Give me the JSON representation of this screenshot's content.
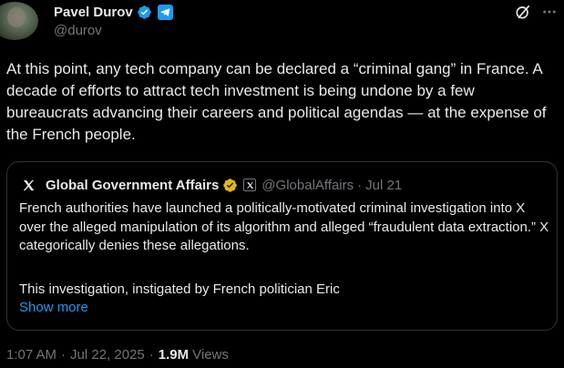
{
  "author": {
    "display_name": "Pavel Durov",
    "handle": "@durov",
    "verified_icon": "blue-verified-check-icon",
    "affiliate_icon": "telegram-icon"
  },
  "tweet": {
    "text": "At this point, any tech company can be declared a “criminal gang” in France. A decade of efforts to attract tech investment is being undone by a few bureaucrats advancing their careers and political agendas — at the expense of the French people."
  },
  "quote": {
    "logo_icon": "x-logo-icon",
    "display_name": "Global Government Affairs",
    "verified_icon": "gold-verified-check-icon",
    "affiliate_icon": "x-affiliate-badge-icon",
    "handle": "@GlobalAffairs",
    "separator": "·",
    "date": "Jul 21",
    "body": "French authorities have launched a politically-motivated criminal investigation into X over the alleged manipulation of its algorithm and alleged “fraudulent data extraction.” X categorically denies these allegations.",
    "body_continued": "This investigation, instigated by French politician Eric",
    "show_more": "Show more"
  },
  "meta": {
    "time": "1:07 AM",
    "separator": "·",
    "date": "Jul 22, 2025",
    "views_count": "1.9M",
    "views_label": "Views"
  },
  "actions": {
    "grok_icon": "grok-icon",
    "more_icon": "more-options-icon"
  },
  "colors": {
    "background": "#000000",
    "text": "#e7e9ea",
    "muted": "#71767b",
    "link": "#1d9bf0",
    "border": "#2f3336",
    "gold": "#e2b719"
  }
}
